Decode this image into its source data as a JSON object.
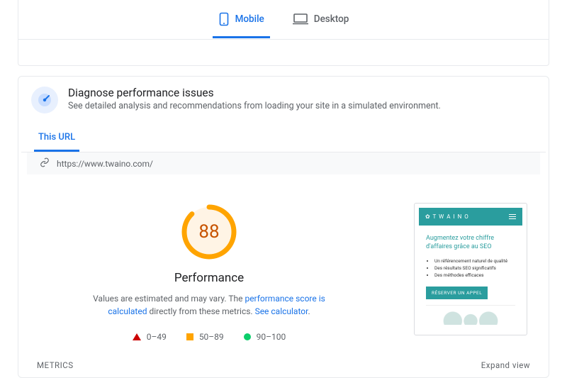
{
  "tabs": {
    "mobile": "Mobile",
    "desktop": "Desktop"
  },
  "diagnose": {
    "title": "Diagnose performance issues",
    "subtitle": "See detailed analysis and recommendations from loading your site in a simulated environment.",
    "subtab": "This URL",
    "url": "https://www.twaino.com/"
  },
  "score": {
    "value": "88",
    "label": "Performance",
    "desc_before": "Values are estimated and may vary. The ",
    "link1": "performance score is calculated",
    "desc_mid": " directly from these metrics. ",
    "link2": "See calculator",
    "desc_after": "."
  },
  "legend": {
    "bad": "0–49",
    "mid": "50–89",
    "good": "90–100"
  },
  "preview": {
    "brand": "✿ T W A I N O",
    "headline": "Augmentez votre chiffre d'affaires grâce au SEO",
    "bullet1": "Un référencement naturel de qualité",
    "bullet2": "Des résultats SEO significatifs",
    "bullet3": "Des méthodes efficaces",
    "cta": "RÉSERVER UN APPEL"
  },
  "footer": {
    "metrics": "METRICS",
    "expand": "Expand view"
  }
}
